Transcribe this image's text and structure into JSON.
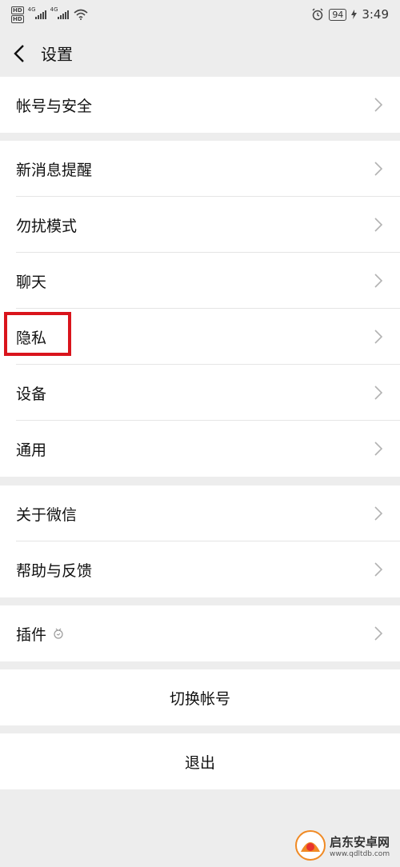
{
  "status_bar": {
    "hd1": "HD",
    "hd2": "HD",
    "signal1": "4G",
    "signal2": "4G",
    "battery": "94",
    "time": "3:49"
  },
  "nav": {
    "title": "设置"
  },
  "groups": {
    "account": {
      "label": "帐号与安全"
    },
    "notifications": {
      "label": "新消息提醒"
    },
    "dnd": {
      "label": "勿扰模式"
    },
    "chat": {
      "label": "聊天"
    },
    "privacy": {
      "label": "隐私"
    },
    "device": {
      "label": "设备"
    },
    "general": {
      "label": "通用"
    },
    "about": {
      "label": "关于微信"
    },
    "help": {
      "label": "帮助与反馈"
    },
    "plugins": {
      "label": "插件"
    }
  },
  "actions": {
    "switch_account": "切换帐号",
    "logout": "退出"
  },
  "watermark": {
    "name": "启东安卓网",
    "url": "www.qdltdb.com"
  },
  "colors": {
    "background": "#ededed",
    "card": "#ffffff",
    "highlight": "#d9141c",
    "chevron": "#b2b2b2"
  }
}
